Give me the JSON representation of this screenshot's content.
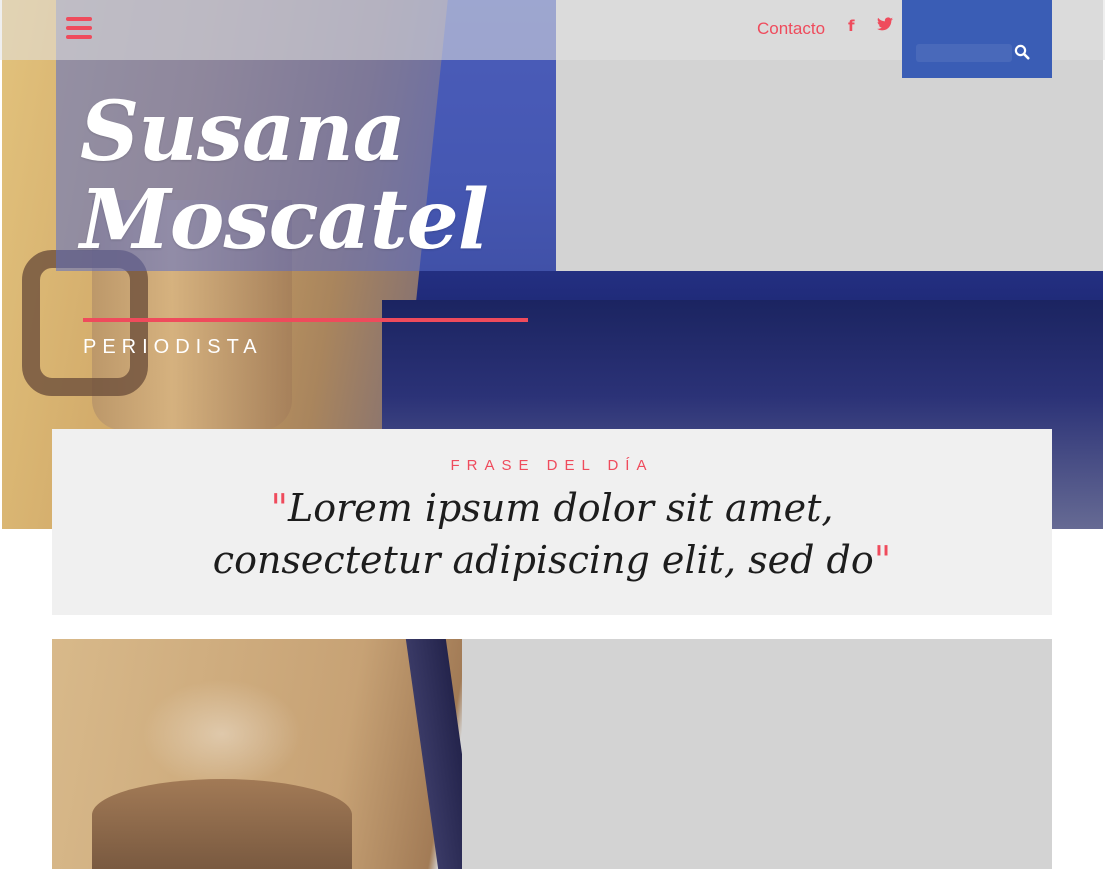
{
  "header": {
    "contact_label": "Contacto",
    "facebook_glyph": "f",
    "twitter_glyph": "🐦",
    "search_placeholder": ""
  },
  "hero": {
    "name": "Susana Moscatel",
    "role": "PERIODISTA"
  },
  "quote": {
    "label": "FRASE DEL DÍA",
    "open_mark": "\"",
    "text": "Lorem ipsum dolor sit amet, consectetur adipiscing elit, sed do",
    "close_mark": "\""
  },
  "colors": {
    "accent": "#ef4b5c",
    "search_bg": "#3a5db5",
    "card_bg": "#f0f0f0"
  },
  "icons": [
    "hamburger-menu-icon",
    "facebook-icon",
    "twitter-icon",
    "search-icon"
  ]
}
